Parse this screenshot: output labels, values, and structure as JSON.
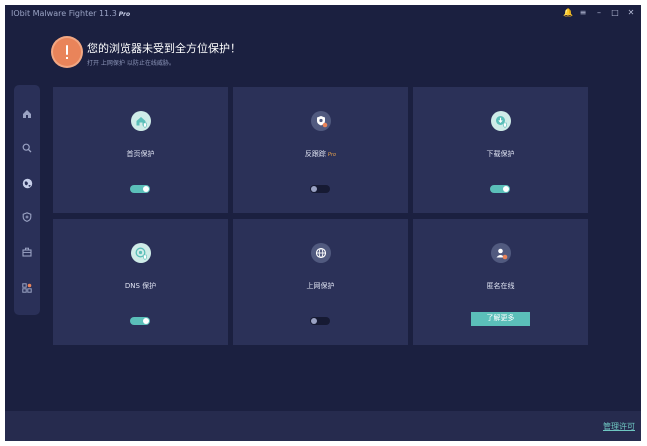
{
  "app": {
    "title": "IObit Malware Fighter 11.3",
    "edition": "Pro"
  },
  "window_controls": [
    {
      "name": "notification-icon",
      "glyph": "🔔"
    },
    {
      "name": "menu-icon",
      "glyph": "≡"
    },
    {
      "name": "minimize-icon",
      "glyph": "–"
    },
    {
      "name": "maximize-icon",
      "glyph": "□"
    },
    {
      "name": "close-icon",
      "glyph": "✕"
    }
  ],
  "banner": {
    "title": "您的浏览器未受到全方位保护！",
    "subtitle": "打开 上网保护 以防止在线威胁。"
  },
  "sidebar": {
    "items": [
      {
        "name": "home-icon",
        "active": false
      },
      {
        "name": "scan-icon",
        "active": false
      },
      {
        "name": "browser-protection-icon",
        "active": true
      },
      {
        "name": "shield-icon",
        "active": false
      },
      {
        "name": "toolbox-icon",
        "active": false
      },
      {
        "name": "more-apps-icon",
        "active": false
      }
    ]
  },
  "cards": [
    {
      "label": "首页保护",
      "icon": "homepage-protection-icon",
      "pro": "",
      "toggle": true
    },
    {
      "label": "反跟踪",
      "icon": "anti-tracking-icon",
      "pro": "Pro",
      "toggle": false
    },
    {
      "label": "下载保护",
      "icon": "download-protection-icon",
      "pro": "",
      "toggle": true
    },
    {
      "label": "DNS 保护",
      "icon": "dns-protection-icon",
      "pro": "",
      "toggle": true
    },
    {
      "label": "上网保护",
      "icon": "surfing-protection-icon",
      "pro": "",
      "toggle": false
    },
    {
      "label": "匿名在线",
      "icon": "anonymous-online-icon",
      "pro": "",
      "toggle": null,
      "button": "了解更多"
    }
  ],
  "footer": {
    "manage_license": "管理许可"
  },
  "colors": {
    "background": "#1b2040",
    "card": "#2b3158",
    "accent": "#5bbfb9",
    "warning": "#e9845a"
  }
}
